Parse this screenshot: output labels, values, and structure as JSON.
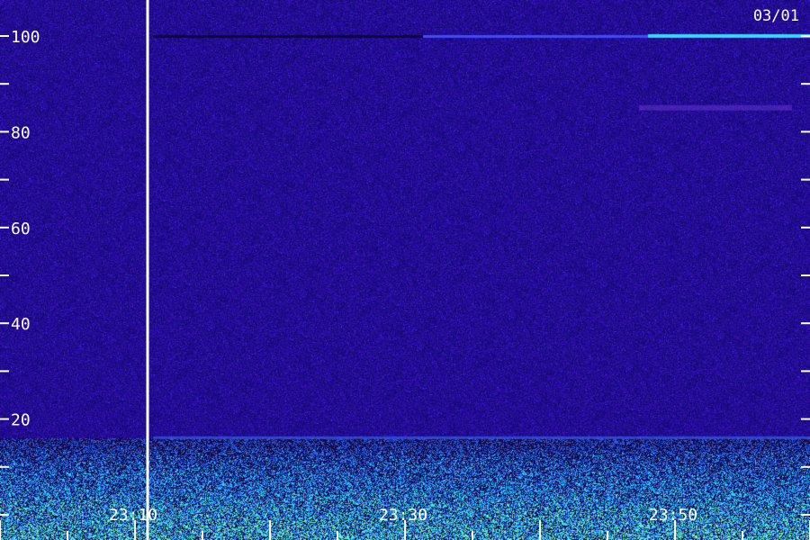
{
  "chart_data": {
    "type": "heatmap",
    "title": "",
    "xlabel": "",
    "ylabel": "",
    "date_label": "03/01",
    "y_axis": {
      "ylim": [
        0,
        100
      ],
      "major_ticks": [
        20,
        40,
        60,
        80,
        100
      ],
      "tick_labels": [
        "20",
        "40",
        "60",
        "80",
        "100"
      ],
      "minor_ticks": [
        0,
        10,
        30,
        50,
        70,
        90
      ]
    },
    "x_axis": {
      "tick_labels": [
        "23:10",
        "23:30",
        "23:50"
      ],
      "segment_break": true
    },
    "colormap": {
      "low": "#150a52",
      "mid": "#3a1fc8",
      "high": "#2fd6ff",
      "peak": "#7dffa0"
    },
    "features": [
      {
        "name": "strong low-frequency band",
        "y_range": [
          0,
          15
        ]
      },
      {
        "name": "horizontal line",
        "y": 100
      },
      {
        "name": "faint band",
        "y": 85
      }
    ],
    "grid": false,
    "legend": "none"
  }
}
